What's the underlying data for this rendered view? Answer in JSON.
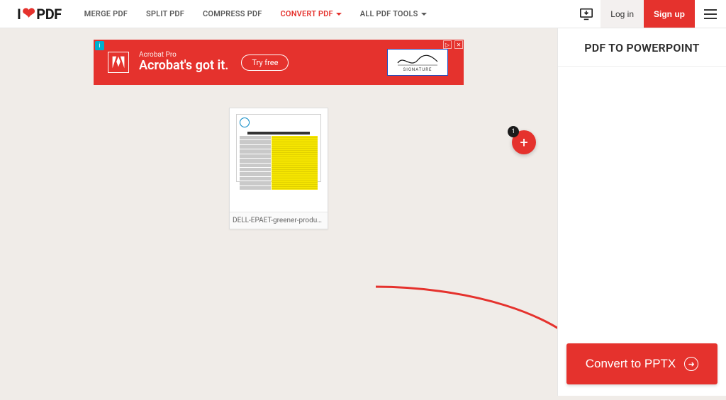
{
  "brand": {
    "pre": "I",
    "post": "PDF"
  },
  "nav": {
    "merge": "MERGE PDF",
    "split": "SPLIT PDF",
    "compress": "COMPRESS PDF",
    "convert": "CONVERT PDF",
    "all": "ALL PDF TOOLS"
  },
  "auth": {
    "login": "Log in",
    "signup": "Sign up"
  },
  "ad": {
    "subtitle": "Acrobat Pro",
    "headline": "Acrobat's got it.",
    "cta": "Try free",
    "sig_label": "SIGNATURE"
  },
  "file": {
    "name": "DELL-EPAET-greener-product.",
    "count": "1"
  },
  "sidebar": {
    "title": "PDF TO POWERPOINT"
  },
  "action": {
    "convert": "Convert to PPTX"
  }
}
